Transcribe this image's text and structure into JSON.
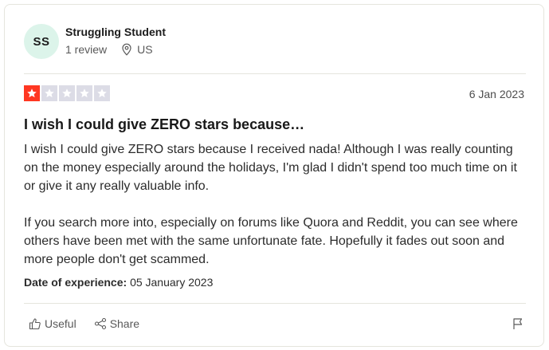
{
  "reviewer": {
    "initials": "SS",
    "name": "Struggling Student",
    "review_count": "1 review",
    "country": "US",
    "avatar_bg": "#dcf4ea"
  },
  "review": {
    "rating": 1,
    "max_rating": 5,
    "star_color_active": "#ff3722",
    "star_color_inactive": "#dcdce6",
    "date": "6 Jan 2023",
    "title": "I wish I could give ZERO stars because…",
    "paragraphs": [
      "I wish I could give ZERO stars because I received nada! Although I was really counting on the money especially around the holidays, I'm glad I didn't spend too much time on it or give it any really valuable info.",
      "If you search more into, especially on forums like Quora and Reddit, you can see where others have been met with the same unfortunate fate. Hopefully it fades out soon and more people don't get scammed."
    ],
    "experience_label": "Date of experience:",
    "experience_date": "05 January 2023"
  },
  "actions": {
    "useful_label": "Useful",
    "share_label": "Share",
    "icons": [
      "thumbs-up-icon",
      "share-icon",
      "flag-icon"
    ]
  }
}
